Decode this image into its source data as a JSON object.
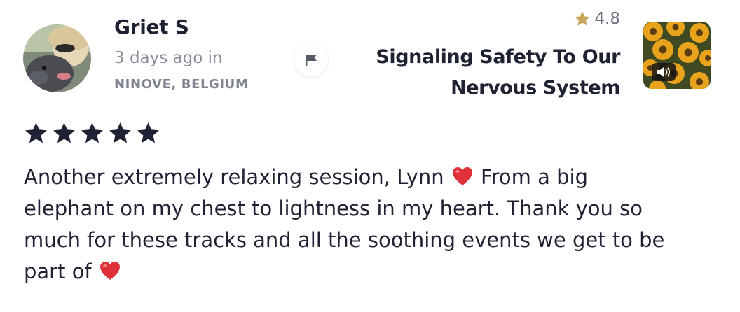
{
  "review": {
    "author": "Griet S",
    "time_ago": "3 days ago in",
    "location": "NINOVE, BELGIUM",
    "stars": 5,
    "text_part1": "Another extremely relaxing session, Lynn",
    "text_part2": " From a big elephant on my chest to lightness in my heart. Thank you so much for these tracks and all the soothing events we get to be part of",
    "emoji": "heart-emoji"
  },
  "track": {
    "rating": "4.8",
    "title": "Signaling Safety To Our Nervous System",
    "badge_icon": "speaker-icon"
  },
  "colors": {
    "text_primary": "#1f2233",
    "text_muted": "#8a8e9b",
    "star_rating": "#c9a55c",
    "heart": "#e0303a"
  }
}
